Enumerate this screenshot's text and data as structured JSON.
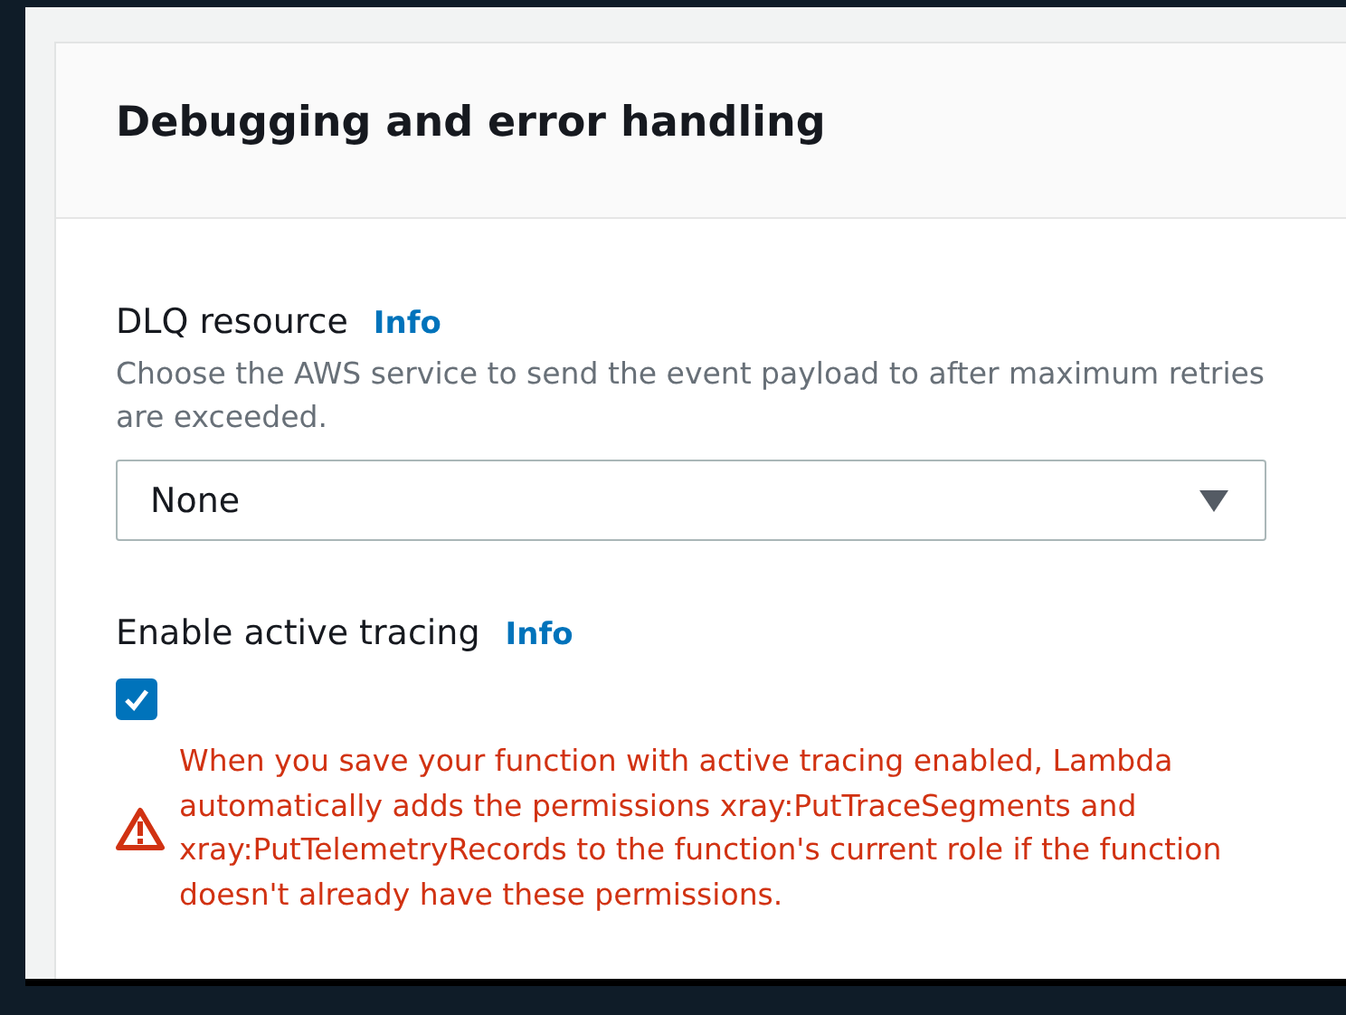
{
  "panel": {
    "title": "Debugging and error handling"
  },
  "dlq": {
    "label": "DLQ resource",
    "info": "Info",
    "description": "Choose the AWS service to send the event payload to after maximum retries are exceeded.",
    "value": "None"
  },
  "tracing": {
    "label": "Enable active tracing",
    "info": "Info",
    "checked": true,
    "warning": "When you save your function with active tracing enabled, Lambda automatically adds the permissions xray:PutTraceSegments and xray:PutTelemetryRecords to the function's current role if the function doesn't already have these permissions."
  }
}
